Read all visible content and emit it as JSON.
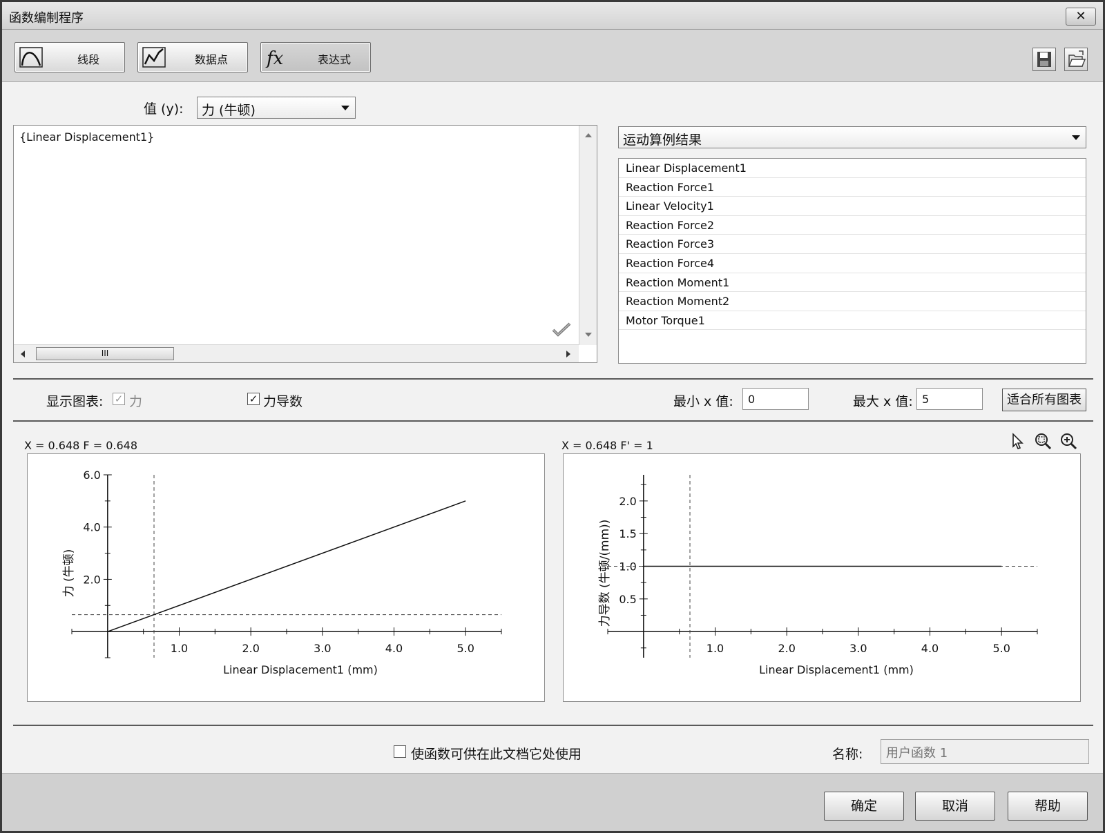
{
  "window": {
    "title": "函数编制程序",
    "close_label": "✕"
  },
  "toolbar": {
    "segment_label": "线段",
    "datapoints_label": "数据点",
    "expression_label": "表达式",
    "expression_icon_text": "fx"
  },
  "value_y": {
    "label": "值 (y):",
    "selected": "力 (牛顿)"
  },
  "expression": {
    "text": "{Linear Displacement1}",
    "scroll_thumb": "III"
  },
  "results": {
    "selected": "运动算例结果",
    "items": [
      "Linear Displacement1",
      "Reaction Force1",
      "Linear Velocity1",
      "Reaction Force2",
      "Reaction Force3",
      "Reaction Force4",
      "Reaction Moment1",
      "Reaction Moment2",
      "Motor Torque1"
    ]
  },
  "display": {
    "show_chart_label": "显示图表:",
    "force_label": "力",
    "force_checked": true,
    "force_enabled": false,
    "derivative_label": "力导数",
    "derivative_checked": true,
    "min_x_label": "最小 x 值:",
    "min_x_value": "0",
    "max_x_label": "最大 x 值:",
    "max_x_value": "5",
    "fit_all_label": "适合所有图表"
  },
  "readouts": {
    "left": "X = 0.648   F = 0.648",
    "right": "X = 0.648   F' = 1"
  },
  "graph_tools": [
    "pointer-icon",
    "zoom-fit-icon",
    "zoom-in-icon"
  ],
  "chart_data": [
    {
      "type": "line",
      "xlabel": "Linear Displacement1 (mm)",
      "ylabel": "力 (牛顿)",
      "x_ticks": [
        "1.0",
        "2.0",
        "3.0",
        "4.0",
        "5.0"
      ],
      "y_ticks": [
        "2.0",
        "4.0",
        "6.0"
      ],
      "xlim": [
        -0.5,
        5.5
      ],
      "ylim": [
        -1.0,
        6.0
      ],
      "series": [
        {
          "x": [
            0,
            5
          ],
          "y": [
            0,
            5
          ]
        }
      ],
      "cursor": {
        "x": 0.648,
        "y": 0.648
      }
    },
    {
      "type": "line",
      "xlabel": "Linear Displacement1 (mm)",
      "ylabel": "力导数 (牛顿/(mm))",
      "x_ticks": [
        "1.0",
        "2.0",
        "3.0",
        "4.0",
        "5.0"
      ],
      "y_ticks": [
        "0.5",
        "1.0",
        "1.5",
        "2.0"
      ],
      "xlim": [
        -0.5,
        5.5
      ],
      "ylim": [
        -0.4,
        2.4
      ],
      "series": [
        {
          "x": [
            0,
            5
          ],
          "y": [
            1,
            1
          ]
        }
      ],
      "cursor": {
        "x": 0.648,
        "y": 1
      }
    }
  ],
  "share": {
    "label": "使函数可供在此文档它处使用",
    "checked": false
  },
  "name": {
    "label": "名称:",
    "value": "用户函数 1"
  },
  "buttons": {
    "ok": "确定",
    "cancel": "取消",
    "help": "帮助"
  }
}
